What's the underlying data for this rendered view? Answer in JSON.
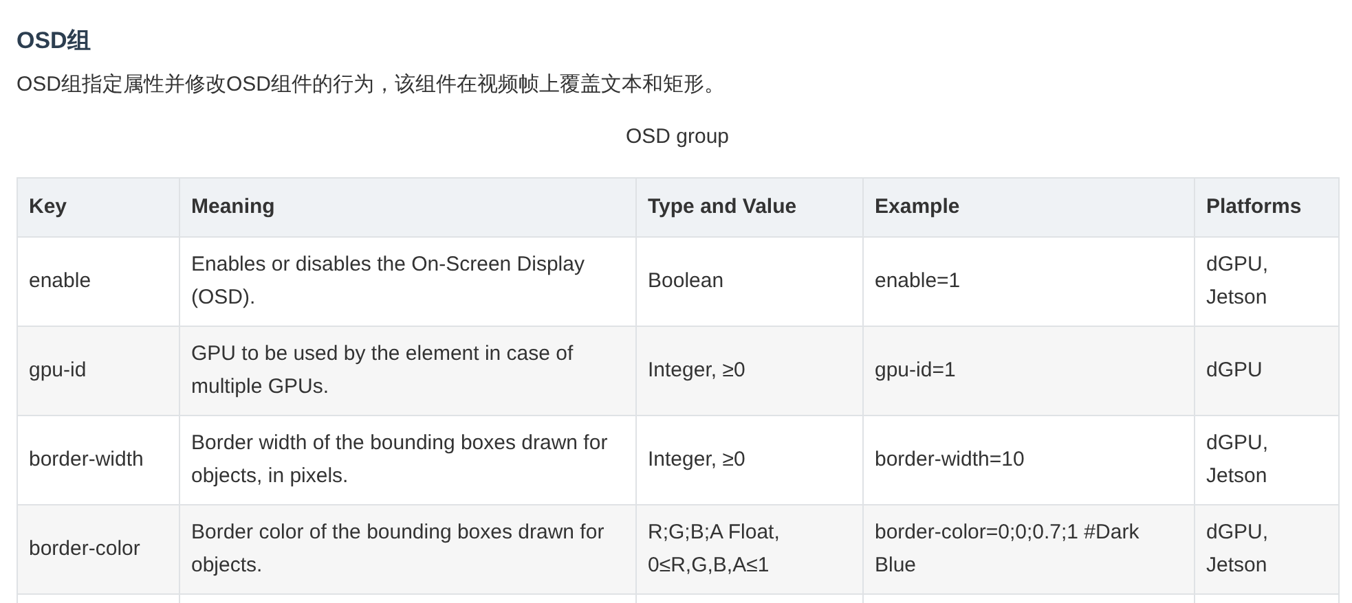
{
  "heading": "OSD组",
  "description": "OSD组指定属性并修改OSD组件的行为，该组件在视频帧上覆盖文本和矩形。",
  "table": {
    "caption": "OSD group",
    "columns": [
      "Key",
      "Meaning",
      "Type and Value",
      "Example",
      "Platforms"
    ],
    "rows": [
      [
        "enable",
        "Enables or disables the On-Screen Display (OSD).",
        "Boolean",
        "enable=1",
        "dGPU, Jetson"
      ],
      [
        "gpu-id",
        "GPU to be used by the element in case of multiple GPUs.",
        "Integer, ≥0",
        "gpu-id=1",
        "dGPU"
      ],
      [
        "border-width",
        "Border width of the bounding boxes drawn for objects, in pixels.",
        "Integer, ≥0",
        "border-width=10",
        "dGPU, Jetson"
      ],
      [
        "border-color",
        "Border color of the bounding boxes drawn for objects.",
        "R;G;B;A Float, 0≤R,G,B,A≤1",
        "border-color=0;0;0.7;1 #Dark Blue",
        "dGPU, Jetson"
      ]
    ]
  }
}
